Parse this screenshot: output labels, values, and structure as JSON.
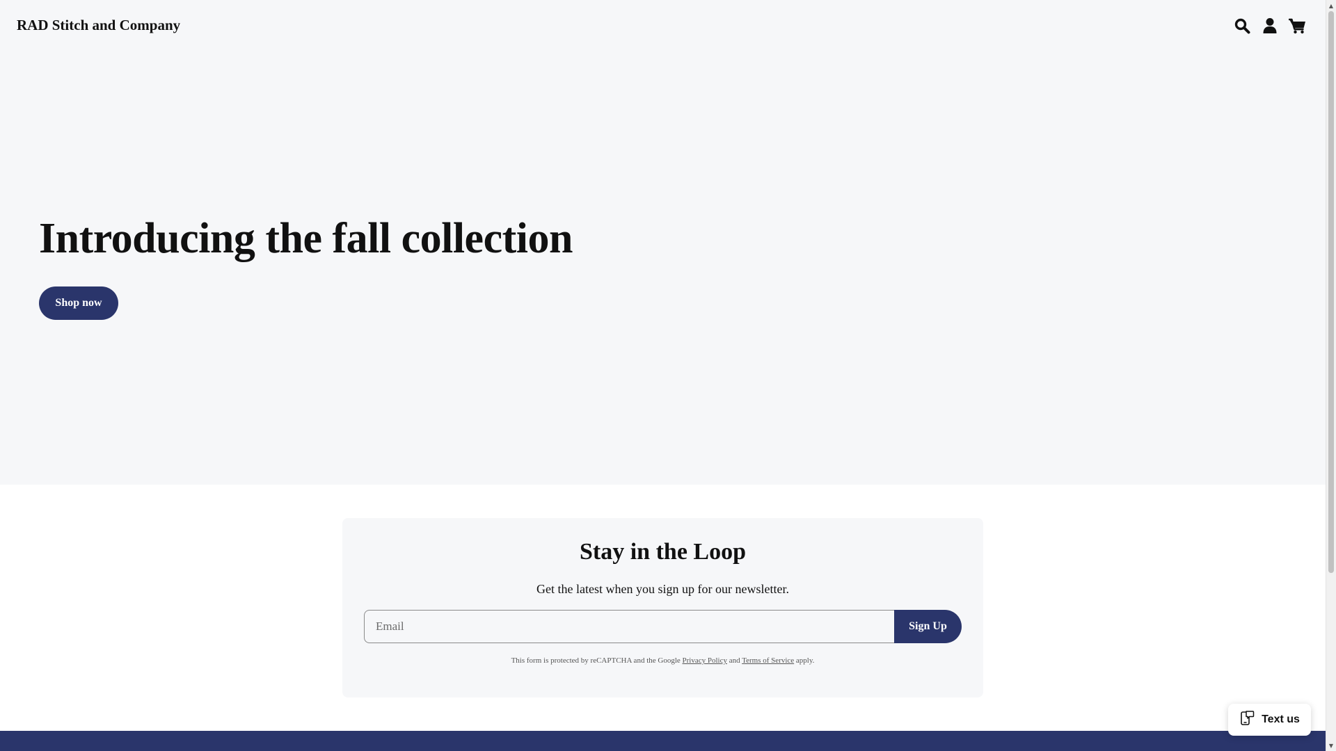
{
  "header": {
    "brand": "RAD Stitch and Company",
    "icons": [
      "search-icon",
      "account-icon",
      "cart-icon"
    ]
  },
  "hero": {
    "title": "Introducing the fall collection",
    "cta_label": "Shop now"
  },
  "newsletter": {
    "title": "Stay in the Loop",
    "subtitle": "Get the latest when you sign up for our newsletter.",
    "email_placeholder": "Email",
    "email_value": "",
    "submit_label": "Sign Up",
    "legal_prefix": "This form is protected by reCAPTCHA and the Google",
    "privacy_link": "Privacy Policy",
    "legal_and": "and",
    "terms_link": "Terms of Service",
    "legal_suffix": "apply."
  },
  "widget": {
    "text_us_label": "Text us",
    "icon": "message-phone-icon"
  },
  "colors": {
    "accent": "#2a356b",
    "background": "#f6f7f9"
  }
}
